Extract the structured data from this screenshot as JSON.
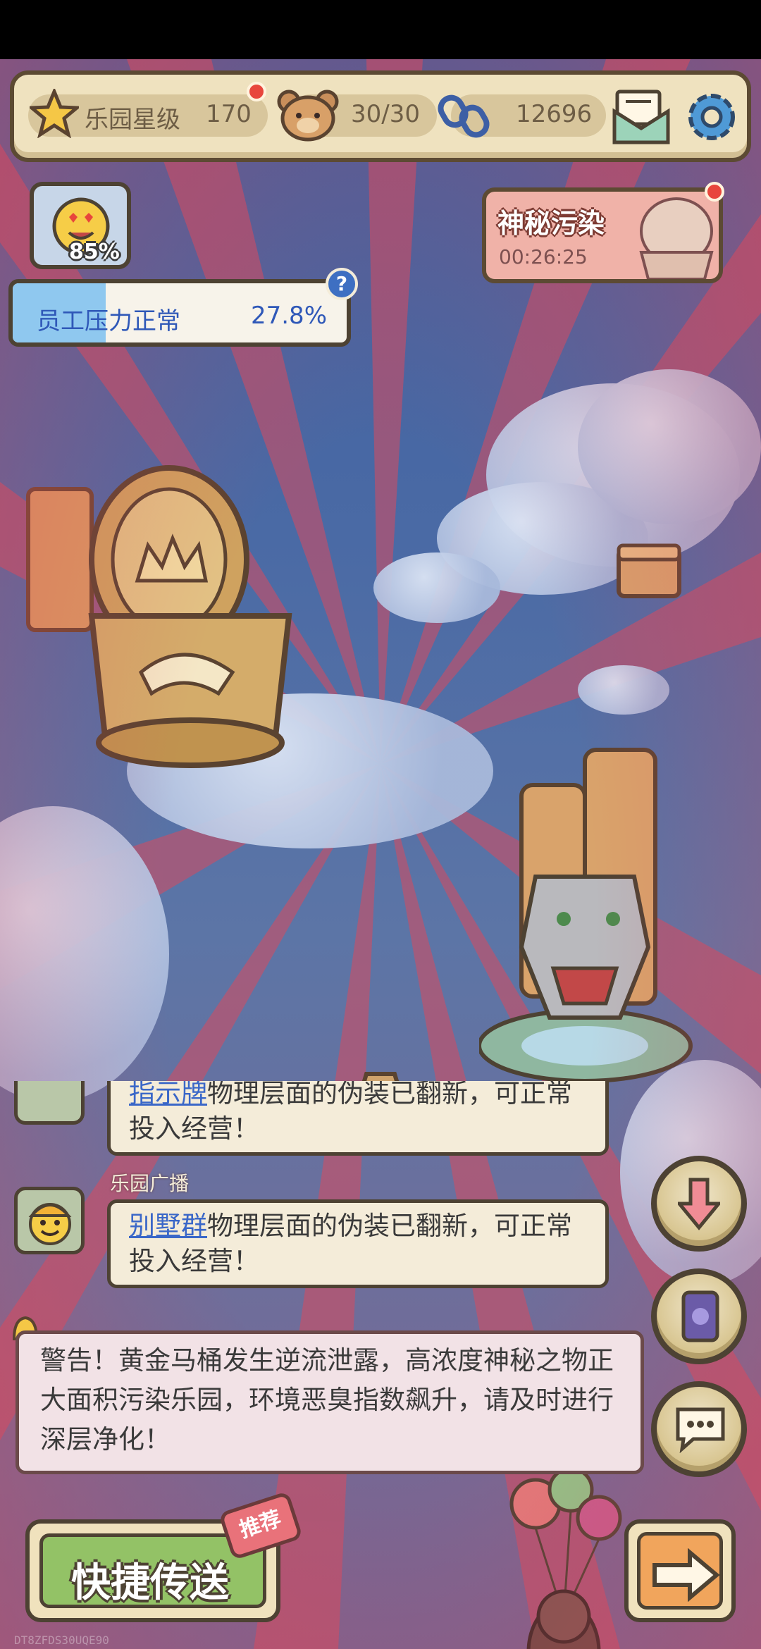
{
  "topbar": {
    "star_label": "乐园星级",
    "star_value": "170",
    "bear_value": "30/30",
    "coin_value": "12696"
  },
  "mood": {
    "percent_text": "85%"
  },
  "stress": {
    "label": "员工压力正常",
    "value": "27.8%",
    "fill_fraction": 0.278,
    "help": "?"
  },
  "event": {
    "title": "神秘污染",
    "timer": "00:26:25"
  },
  "feed": {
    "msg1": {
      "highlight": "指示牌",
      "text": "物理层面的伪装已翻新，可正常投入经营！"
    },
    "sender": "乐园广播",
    "msg2": {
      "highlight": "别墅群",
      "text": "物理层面的伪装已翻新，可正常投入经营！"
    }
  },
  "warning": {
    "text": "警告！黄金马桶发生逆流泄露，高浓度神秘之物正大面积污染乐园，环境恶臭指数飙升，请及时进行深层净化！"
  },
  "actions": {
    "quick_teleport": "快捷传送",
    "recommend_badge": "推荐"
  },
  "watermark": "DT8ZFDS30UQE90",
  "colors": {
    "accent_blue": "#2f58b8",
    "alert_red": "#e8463c",
    "panel": "#efe2bf",
    "green_button": "#93c266"
  }
}
